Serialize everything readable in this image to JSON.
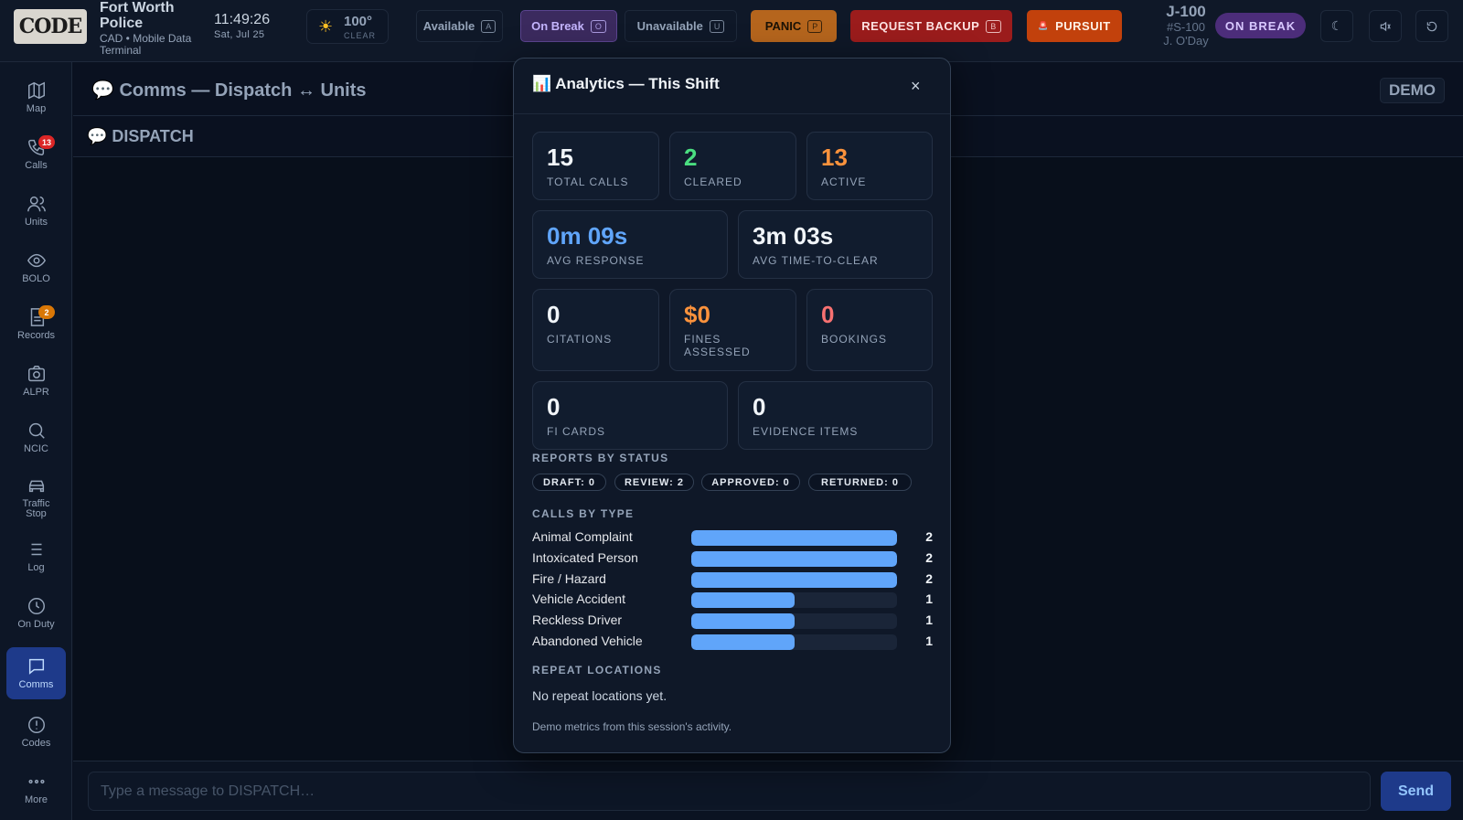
{
  "topbar": {
    "logo_text": "CODE",
    "agency_name": "Fort Worth Police",
    "agency_sub": "CAD • Mobile Data Terminal",
    "time": "11:49:26",
    "date": "Sat, Jul 25",
    "weather_icon": "sun-icon",
    "weather_temp": "100°",
    "weather_cond": "CLEAR",
    "status_buttons": {
      "available": {
        "label": "Available",
        "key": "A"
      },
      "on_break": {
        "label": "On Break",
        "key": "O"
      },
      "unavailable": {
        "label": "Unavailable",
        "key": "U"
      }
    },
    "panic": {
      "label": "PANIC",
      "key": "P"
    },
    "backup": {
      "label": "REQUEST BACKUP",
      "key": "B"
    },
    "pursuit": {
      "label": "PURSUIT",
      "icon": "siren-icon"
    },
    "unit": {
      "callsign": "J-100",
      "number": "#S-100",
      "officer": "J. O'Day"
    },
    "status_pill": "ON BREAK",
    "colors": {
      "break": "#4c2d7a",
      "panic": "#b5651d",
      "backup": "#9b1c1c",
      "pursuit": "#c2410c"
    }
  },
  "sidebar": {
    "items": [
      {
        "label": "Map",
        "icon": "map-icon"
      },
      {
        "label": "Calls",
        "icon": "phone-icon",
        "badge": "13"
      },
      {
        "label": "Units",
        "icon": "users-icon"
      },
      {
        "label": "BOLO",
        "icon": "eye-icon"
      },
      {
        "label": "Records",
        "icon": "document-icon",
        "badge": "2"
      },
      {
        "label": "ALPR",
        "icon": "camera-icon"
      },
      {
        "label": "NCIC",
        "icon": "search-icon"
      },
      {
        "label": "Traffic Stop",
        "icon": "car-icon"
      },
      {
        "label": "Log",
        "icon": "list-icon"
      },
      {
        "label": "On Duty",
        "icon": "clock-icon"
      },
      {
        "label": "Comms",
        "icon": "chat-icon",
        "active": true
      },
      {
        "label": "Codes",
        "icon": "info-icon"
      },
      {
        "label": "More",
        "icon": "more-icon"
      }
    ]
  },
  "main": {
    "title": "💬 Comms — Dispatch ↔ Units",
    "demo_badge": "DEMO",
    "channel": "💬 DISPATCH",
    "composer": {
      "placeholder": "Type a message to DISPATCH…",
      "send_label": "Send"
    }
  },
  "analytics": {
    "title": "📊 Analytics — This Shift",
    "close": "×",
    "stats": {
      "total_calls": {
        "value": "15",
        "label": "TOTAL CALLS"
      },
      "cleared": {
        "value": "2",
        "label": "CLEARED"
      },
      "active": {
        "value": "13",
        "label": "ACTIVE"
      },
      "avg_response": {
        "value": "0m 09s",
        "label": "AVG RESPONSE"
      },
      "avg_clear": {
        "value": "3m 03s",
        "label": "AVG TIME-TO-CLEAR"
      },
      "citations": {
        "value": "0",
        "label": "CITATIONS"
      },
      "fines": {
        "value": "$0",
        "label": "FINES ASSESSED"
      },
      "bookings": {
        "value": "0",
        "label": "BOOKINGS"
      },
      "fi_cards": {
        "value": "0",
        "label": "FI CARDS"
      },
      "evidence": {
        "value": "0",
        "label": "EVIDENCE ITEMS"
      }
    },
    "reports_title": "REPORTS BY STATUS",
    "reports": [
      "DRAFT: 0",
      "REVIEW: 2",
      "APPROVED: 0",
      "RETURNED: 0"
    ],
    "calls_title": "CALLS BY TYPE",
    "calls_by_type": [
      {
        "type": "Animal Complaint",
        "count": 2,
        "fill": 1.0
      },
      {
        "type": "Intoxicated Person",
        "count": 2,
        "fill": 1.0
      },
      {
        "type": "Fire / Hazard",
        "count": 2,
        "fill": 1.0
      },
      {
        "type": "Vehicle Accident",
        "count": 1,
        "fill": 0.5
      },
      {
        "type": "Reckless Driver",
        "count": 1,
        "fill": 0.5
      },
      {
        "type": "Abandoned Vehicle",
        "count": 1,
        "fill": 0.5
      }
    ],
    "repeat_title": "REPEAT LOCATIONS",
    "repeat_text": "No repeat locations yet.",
    "footnote": "Demo metrics from this session's activity."
  }
}
